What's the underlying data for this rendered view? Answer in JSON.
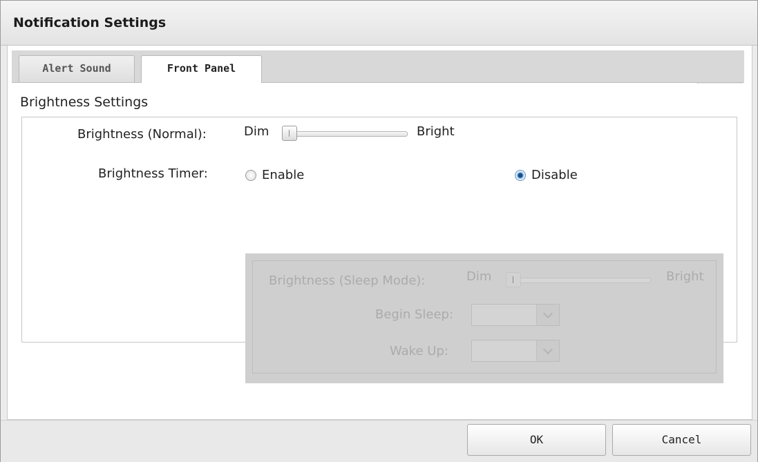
{
  "dialog": {
    "title": "Notification Settings"
  },
  "help": {
    "icon": "help-icon",
    "glyph": "?",
    "dropdown_icon": "chevron-down-icon"
  },
  "tabs": [
    {
      "label": "Alert Sound",
      "active": false
    },
    {
      "label": "Front Panel",
      "active": true
    }
  ],
  "section": {
    "title": "Brightness Settings"
  },
  "brightness_normal": {
    "label": "Brightness (Normal):",
    "min_label": "Dim",
    "max_label": "Bright",
    "level": 0
  },
  "brightness_timer": {
    "label": "Brightness Timer:",
    "options": [
      {
        "label": "Enable",
        "checked": false
      },
      {
        "label": "Disable",
        "checked": true
      }
    ]
  },
  "sleep_settings": {
    "disabled": true,
    "brightness_sleep": {
      "label": "Brightness (Sleep Mode):",
      "min_label": "Dim",
      "max_label": "Bright",
      "level": 0
    },
    "begin_sleep": {
      "label": "Begin Sleep:",
      "value": ""
    },
    "wake_up": {
      "label": "Wake Up:",
      "value": ""
    }
  },
  "footer": {
    "ok_label": "OK",
    "cancel_label": "Cancel"
  },
  "colors": {
    "accent": "#1f6fc5",
    "disabled_bg": "#cfcfcf",
    "disabled_text": "#ababab"
  }
}
